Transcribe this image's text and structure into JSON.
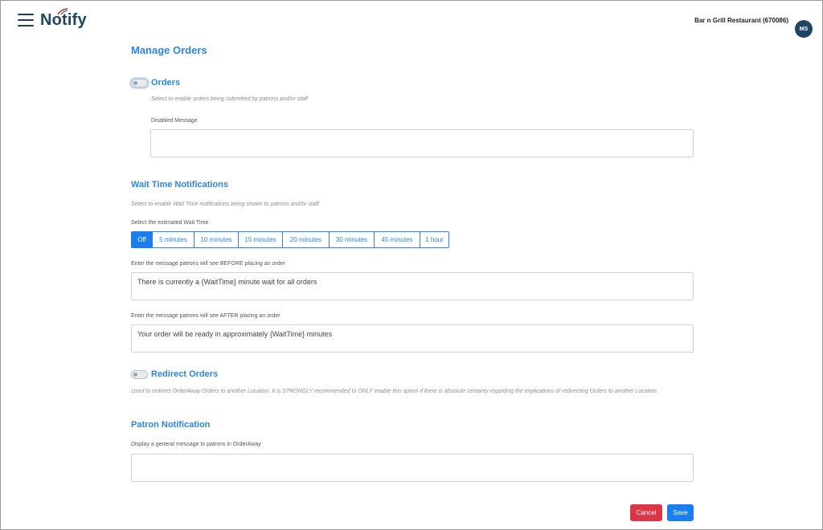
{
  "app": {
    "name": "Notify",
    "location": "Bar n Grill Restaurant (670086)",
    "user_initials": "MS"
  },
  "page": {
    "title": "Manage Orders"
  },
  "orders": {
    "label": "Orders",
    "hint": "Select to enable orders being submitted by patrons and/or staff",
    "disabled_message_label": "Disabled Message",
    "disabled_message_value": "",
    "enabled": false
  },
  "wait_time": {
    "label": "Wait Time Notifications",
    "hint": "Select to enable Wait Time notifications being shown to patrons and/or staff",
    "select_label": "Select the estimated Wait Time",
    "options": [
      "Off",
      "5 minutes",
      "10 minutes",
      "15 minutes",
      "20 minutes",
      "30 minutes",
      "45 minutes",
      "1 hour"
    ],
    "selected": "Off",
    "before_label": "Enter the message patrons will see BEFORE placing an order",
    "before_value": "There is currently a {WaitTime} minute wait for all orders",
    "after_label": "Enter the message patrons will see AFTER placing an order",
    "after_value": "Your order will be ready in approximately {WaitTime} minutes"
  },
  "redirect": {
    "label": "Redirect Orders",
    "hint": "Used to redirect OrderAway Orders to another Location. It is STRONGLY recommended to ONLY enable this option if there is absolute certainty regarding the implications of redirecting Orders to another Location.",
    "enabled": false
  },
  "patron_notification": {
    "label": "Patron Notification",
    "message_label": "Display a general message to patrons in OrderAway",
    "message_value": ""
  },
  "actions": {
    "cancel": "Cancel",
    "save": "Save"
  },
  "colors": {
    "accent": "#2a87e0",
    "primary": "#1a7ef0",
    "danger": "#dc3545",
    "brand": "#1e4466"
  }
}
